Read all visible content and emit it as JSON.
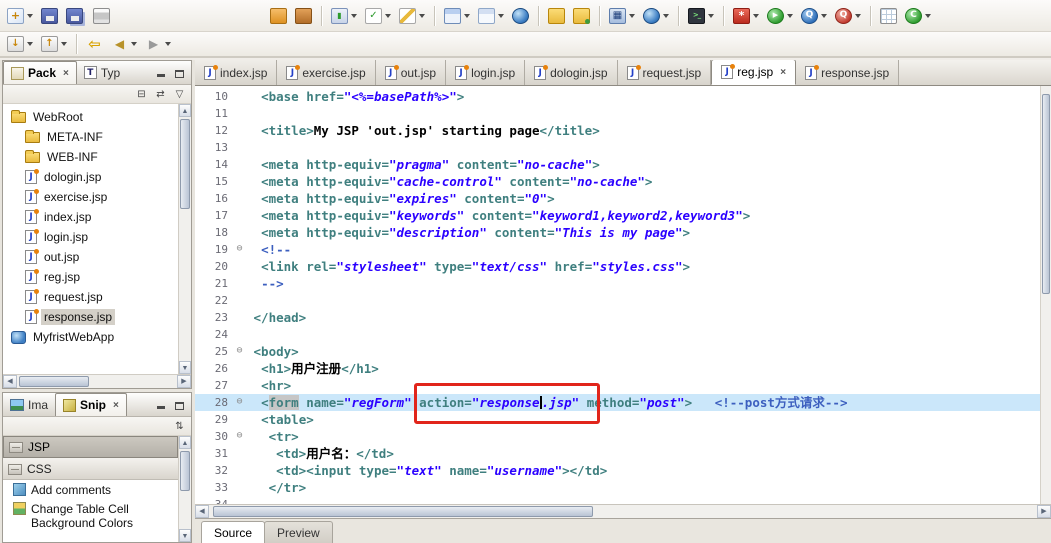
{
  "ui": {
    "close_glyph": "×",
    "fold_glyph": "⊖",
    "up_glyph": "▲",
    "down_glyph": "▼",
    "left_glyph": "◀",
    "right_glyph": "▶"
  },
  "colors": {
    "annotation_red": "#E1251B",
    "current_line_highlight": "#CBE7FA",
    "tag_color": "#3F7F7F",
    "attr_value_color": "#2A00FF",
    "comment_color": "#3C5FBF"
  },
  "toolbar_main": {
    "items": [
      {
        "name": "new-wizard",
        "icon": "new",
        "glyph": "+",
        "dd": true
      },
      {
        "name": "save",
        "icon": "save",
        "glyph": ""
      },
      {
        "name": "save-all",
        "icon": "saveall",
        "glyph": ""
      },
      {
        "name": "print",
        "icon": "print",
        "glyph": ""
      },
      {
        "space": 150
      },
      {
        "name": "deploy-project",
        "icon": "deploy",
        "glyph": ""
      },
      {
        "name": "project-archive",
        "icon": "package",
        "glyph": ""
      },
      {
        "sep": true
      },
      {
        "name": "run-on-server",
        "icon": "server",
        "glyph": "▮",
        "dd": true
      },
      {
        "name": "validate",
        "icon": "validate",
        "glyph": "✓",
        "dd": true
      },
      {
        "name": "edit-attachment",
        "icon": "edit",
        "glyph": "",
        "dd": true
      },
      {
        "sep": true
      },
      {
        "name": "new-window",
        "icon": "window",
        "glyph": "",
        "dd": true
      },
      {
        "name": "open-perspective",
        "icon": "window2",
        "glyph": "",
        "dd": true
      },
      {
        "name": "web-browser",
        "icon": "globe",
        "glyph": ""
      },
      {
        "sep": true
      },
      {
        "name": "open-file",
        "icon": "folder",
        "glyph": ""
      },
      {
        "name": "import-resources",
        "icon": "folder2",
        "glyph": ""
      },
      {
        "sep": true
      },
      {
        "name": "new-web-project",
        "icon": "proj",
        "glyph": "▦",
        "dd": true
      },
      {
        "name": "preview-in-browser",
        "icon": "globe",
        "glyph": "",
        "dd": true
      },
      {
        "sep": true
      },
      {
        "name": "console",
        "icon": "console",
        "glyph": ">_",
        "dd": true
      },
      {
        "sep": true
      },
      {
        "name": "external-tools",
        "icon": "tools",
        "glyph": "*",
        "dd": true
      },
      {
        "name": "run",
        "icon": "run",
        "glyph": "▶",
        "dd": true
      },
      {
        "name": "debug-search",
        "icon": "qblue",
        "glyph": "Q",
        "dd": true
      },
      {
        "name": "profile",
        "icon": "qred",
        "glyph": "Q",
        "dd": true
      },
      {
        "sep": true
      },
      {
        "name": "data-table",
        "icon": "grid",
        "glyph": ""
      },
      {
        "name": "code-coverage",
        "icon": "crec",
        "glyph": "C",
        "dd": true
      }
    ]
  },
  "toolbar_nav": {
    "items": [
      {
        "name": "next-annotation",
        "icon": "annot",
        "glyph": "↓",
        "dd": true
      },
      {
        "name": "previous-annotation",
        "icon": "annot",
        "glyph": "↑",
        "dd": true
      },
      {
        "sep": true
      },
      {
        "name": "last-edit-location",
        "icon": "backy",
        "glyph": "⇦"
      },
      {
        "name": "back-history",
        "icon": "back",
        "glyph": "◀",
        "dd": true
      },
      {
        "name": "forward-history",
        "icon": "fwd",
        "glyph": "▶",
        "dd": true
      }
    ]
  },
  "explorer": {
    "tabs": [
      {
        "label": "Pack",
        "icon": "pkgexp",
        "active": true,
        "closable": true
      },
      {
        "label": "Typ",
        "icon": "typehier"
      }
    ],
    "toolbar": [
      {
        "name": "collapse-all",
        "glyph": "⊟"
      },
      {
        "name": "link-with-editor",
        "glyph": "⇄"
      },
      {
        "name": "view-menu",
        "glyph": "▽"
      }
    ],
    "tree": [
      {
        "label": "WebRoot",
        "type": "folder",
        "level": 0,
        "open": true
      },
      {
        "label": "META-INF",
        "type": "folder",
        "level": 1
      },
      {
        "label": "WEB-INF",
        "type": "folder",
        "level": 1
      },
      {
        "label": "dologin.jsp",
        "type": "jsp",
        "level": 1
      },
      {
        "label": "exercise.jsp",
        "type": "jsp",
        "level": 1
      },
      {
        "label": "index.jsp",
        "type": "jsp",
        "level": 1
      },
      {
        "label": "login.jsp",
        "type": "jsp",
        "level": 1
      },
      {
        "label": "out.jsp",
        "type": "jsp",
        "level": 1
      },
      {
        "label": "reg.jsp",
        "type": "jsp",
        "level": 1
      },
      {
        "label": "request.jsp",
        "type": "jsp",
        "level": 1
      },
      {
        "label": "response.jsp",
        "type": "jsp",
        "level": 1,
        "selected": true
      },
      {
        "label": "MyfristWebApp",
        "type": "project",
        "level": 0
      }
    ]
  },
  "snippets": {
    "tabs": [
      {
        "label": "Ima",
        "icon": "image"
      },
      {
        "label": "Snip",
        "icon": "snip",
        "active": true,
        "closable": true
      }
    ],
    "toolbar": [
      {
        "name": "palette-layout",
        "glyph": "⇅"
      }
    ],
    "drawers": [
      {
        "label": "JSP",
        "selected": true
      },
      {
        "label": "CSS"
      }
    ],
    "items": [
      {
        "label": "Add comments"
      },
      {
        "label": "Change Table Cell Background Colors"
      }
    ]
  },
  "editor": {
    "tabs": [
      {
        "label": "index.jsp"
      },
      {
        "label": "exercise.jsp"
      },
      {
        "label": "out.jsp"
      },
      {
        "label": "login.jsp"
      },
      {
        "label": "dologin.jsp"
      },
      {
        "label": "request.jsp"
      },
      {
        "label": "reg.jsp",
        "active": true,
        "closable": true
      },
      {
        "label": "response.jsp"
      }
    ],
    "page_tabs": [
      {
        "label": "Source",
        "active": true
      },
      {
        "label": "Preview"
      }
    ],
    "lines": [
      {
        "n": 10,
        "tokens": [
          [
            "  ",
            "pl"
          ],
          [
            "<base ",
            "tag"
          ],
          [
            "href=",
            "tag"
          ],
          [
            "\"<%=basePath%>\"",
            "val"
          ],
          [
            ">",
            "tag"
          ]
        ]
      },
      {
        "n": 11,
        "tokens": []
      },
      {
        "n": 12,
        "tokens": [
          [
            "  ",
            "pl"
          ],
          [
            "<title>",
            "tag"
          ],
          [
            "My JSP 'out.jsp' starting page",
            "txt"
          ],
          [
            "</title>",
            "tag"
          ]
        ]
      },
      {
        "n": 13,
        "tokens": []
      },
      {
        "n": 14,
        "tokens": [
          [
            "  ",
            "pl"
          ],
          [
            "<meta ",
            "tag"
          ],
          [
            "http-equiv=",
            "tag"
          ],
          [
            "\"pragma\"",
            "val"
          ],
          [
            " content=",
            "tag"
          ],
          [
            "\"no-cache\"",
            "val"
          ],
          [
            ">",
            "tag"
          ]
        ]
      },
      {
        "n": 15,
        "tokens": [
          [
            "  ",
            "pl"
          ],
          [
            "<meta ",
            "tag"
          ],
          [
            "http-equiv=",
            "tag"
          ],
          [
            "\"cache-control\"",
            "val"
          ],
          [
            " content=",
            "tag"
          ],
          [
            "\"no-cache\"",
            "val"
          ],
          [
            ">",
            "tag"
          ]
        ]
      },
      {
        "n": 16,
        "tokens": [
          [
            "  ",
            "pl"
          ],
          [
            "<meta ",
            "tag"
          ],
          [
            "http-equiv=",
            "tag"
          ],
          [
            "\"expires\"",
            "val"
          ],
          [
            " content=",
            "tag"
          ],
          [
            "\"0\"",
            "val"
          ],
          [
            ">",
            "tag"
          ]
        ]
      },
      {
        "n": 17,
        "tokens": [
          [
            "  ",
            "pl"
          ],
          [
            "<meta ",
            "tag"
          ],
          [
            "http-equiv=",
            "tag"
          ],
          [
            "\"keywords\"",
            "val"
          ],
          [
            " content=",
            "tag"
          ],
          [
            "\"keyword1,keyword2,keyword3\"",
            "val"
          ],
          [
            ">",
            "tag"
          ]
        ]
      },
      {
        "n": 18,
        "tokens": [
          [
            "  ",
            "pl"
          ],
          [
            "<meta ",
            "tag"
          ],
          [
            "http-equiv=",
            "tag"
          ],
          [
            "\"description\"",
            "val"
          ],
          [
            " content=",
            "tag"
          ],
          [
            "\"This is my page\"",
            "val"
          ],
          [
            ">",
            "tag"
          ]
        ]
      },
      {
        "n": 19,
        "fold": true,
        "tokens": [
          [
            "  ",
            "pl"
          ],
          [
            "<!--",
            "cm"
          ]
        ]
      },
      {
        "n": 20,
        "tokens": [
          [
            "  ",
            "pl"
          ],
          [
            "<link ",
            "tag"
          ],
          [
            "rel=",
            "tag"
          ],
          [
            "\"stylesheet\"",
            "val"
          ],
          [
            " type=",
            "tag"
          ],
          [
            "\"text/css\"",
            "val"
          ],
          [
            " href=",
            "tag"
          ],
          [
            "\"styles.css\"",
            "val"
          ],
          [
            ">",
            "tag"
          ]
        ]
      },
      {
        "n": 21,
        "tokens": [
          [
            "  ",
            "pl"
          ],
          [
            "-->",
            "cm"
          ]
        ]
      },
      {
        "n": 22,
        "tokens": []
      },
      {
        "n": 23,
        "tokens": [
          [
            " ",
            "pl"
          ],
          [
            "</head>",
            "tag"
          ]
        ]
      },
      {
        "n": 24,
        "tokens": []
      },
      {
        "n": 25,
        "fold": true,
        "tokens": [
          [
            " ",
            "pl"
          ],
          [
            "<body>",
            "tag"
          ]
        ]
      },
      {
        "n": 26,
        "tokens": [
          [
            "  ",
            "pl"
          ],
          [
            "<h1>",
            "tag"
          ],
          [
            "用户注册",
            "txt"
          ],
          [
            "</h1>",
            "tag"
          ]
        ]
      },
      {
        "n": 27,
        "tokens": [
          [
            "  ",
            "pl"
          ],
          [
            "<hr>",
            "tag"
          ]
        ]
      },
      {
        "n": 28,
        "fold": true,
        "current": true,
        "tokens": [
          [
            "  ",
            "pl"
          ],
          [
            "<",
            "tag"
          ],
          [
            "form",
            "occ"
          ],
          [
            " ",
            "pl"
          ],
          [
            "name=",
            "tag"
          ],
          [
            "\"regForm\"",
            "val"
          ],
          [
            " ",
            "pl"
          ],
          [
            "action=",
            "tag"
          ],
          [
            "\"response",
            "val"
          ],
          [
            "",
            "caret"
          ],
          [
            ".jsp\"",
            "val"
          ],
          [
            " ",
            "pl"
          ],
          [
            "method=",
            "tag"
          ],
          [
            "\"post\"",
            "val"
          ],
          [
            ">",
            "tag"
          ],
          [
            "   ",
            "pl"
          ],
          [
            "<!--post方式请求-->",
            "cm"
          ]
        ]
      },
      {
        "n": 29,
        "tokens": [
          [
            "  ",
            "pl"
          ],
          [
            "<table>",
            "tag"
          ]
        ]
      },
      {
        "n": 30,
        "fold": true,
        "tokens": [
          [
            "   ",
            "pl"
          ],
          [
            "<tr>",
            "tag"
          ]
        ]
      },
      {
        "n": 31,
        "tokens": [
          [
            "    ",
            "pl"
          ],
          [
            "<td>",
            "tag"
          ],
          [
            "用户名：",
            "txt"
          ],
          [
            "</td>",
            "tag"
          ]
        ]
      },
      {
        "n": 32,
        "tokens": [
          [
            "    ",
            "pl"
          ],
          [
            "<td><input ",
            "tag"
          ],
          [
            "type=",
            "tag"
          ],
          [
            "\"text\"",
            "val"
          ],
          [
            " name=",
            "tag"
          ],
          [
            "\"username\"",
            "val"
          ],
          [
            "></td>",
            "tag"
          ]
        ]
      },
      {
        "n": 33,
        "tokens": [
          [
            "   ",
            "pl"
          ],
          [
            "</tr>",
            "tag"
          ]
        ]
      },
      {
        "n": 34,
        "tokens": []
      }
    ]
  }
}
